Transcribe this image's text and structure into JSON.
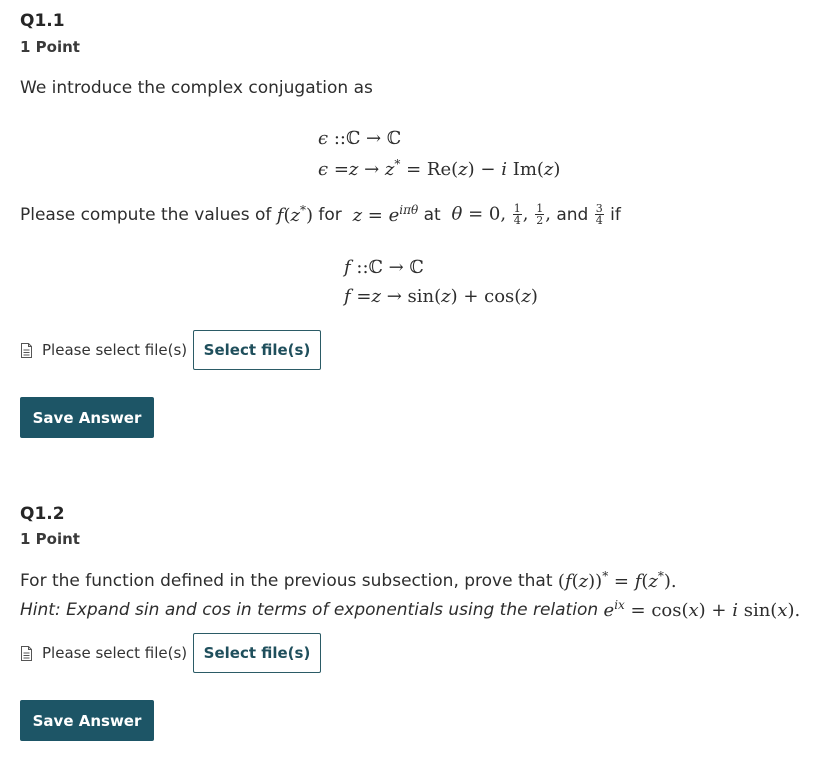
{
  "q1": {
    "title": "Q1.1",
    "points": "1 Point",
    "intro": "We introduce the complex conjugation as",
    "math_line1": "ϵ ::ℂ → ℂ",
    "math_line2": "ϵ =z → z* = Re(z) − i Im(z)",
    "compute_prefix": "Please compute the values of ",
    "compute_mid1": " for ",
    "compute_mid2": " at ",
    "compute_and": "and",
    "compute_if": "if",
    "fdef_line1": "f ::ℂ → ℂ",
    "fdef_line2": "f =z → sin(z) + cos(z)",
    "file_prompt": "Please select file(s)",
    "select_label": "Select file(s)",
    "save_label": "Save Answer"
  },
  "q2": {
    "title": "Q1.2",
    "points": "1 Point",
    "statement_prefix": "For the function defined in the previous subsection, prove that ",
    "hint_prefix": "Hint: Expand sin and cos in terms of exponentials using the relation ",
    "file_prompt": "Please select file(s)",
    "select_label": "Select file(s)",
    "save_label": "Save Answer"
  },
  "icons": {
    "file": "document-icon"
  },
  "colors": {
    "save_button_bg": "#1d5566",
    "select_button_border": "#2b5b66",
    "text": "#2d2d2d"
  }
}
